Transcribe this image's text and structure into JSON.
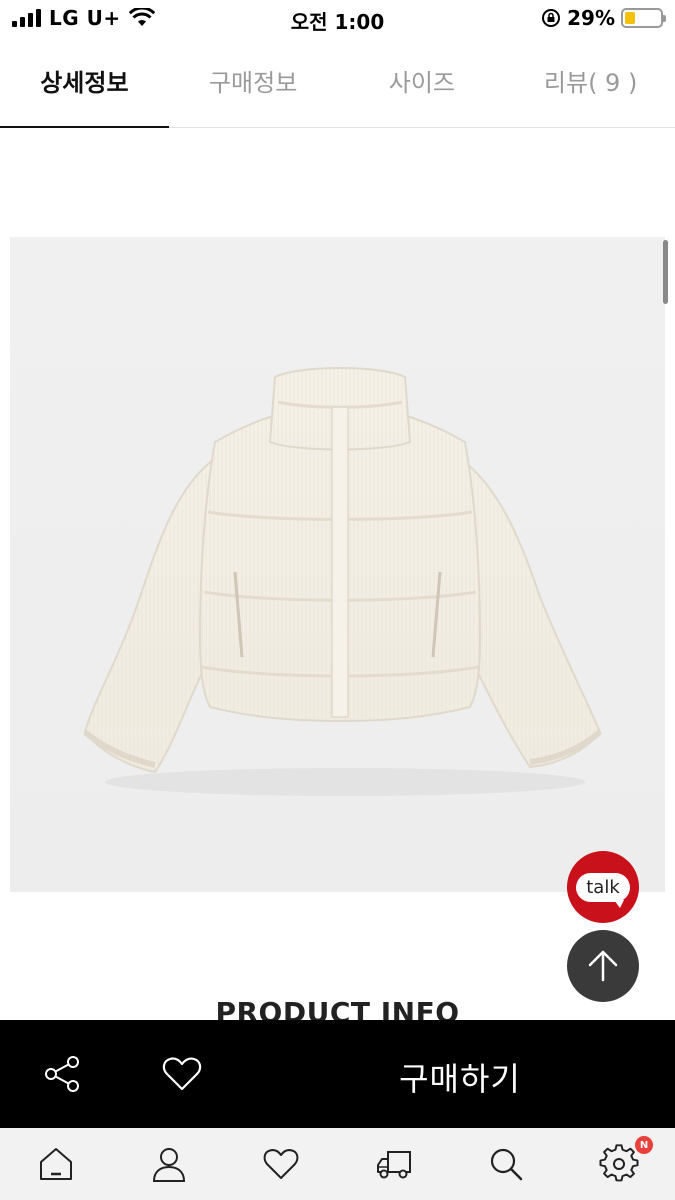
{
  "status_bar": {
    "carrier": "LG U+",
    "time": "오전 1:00",
    "battery_percent_text": "29%",
    "battery_level": 0.29
  },
  "tabs": [
    {
      "label": "상세정보",
      "active": true
    },
    {
      "label": "구매정보",
      "active": false
    },
    {
      "label": "사이즈",
      "active": false
    },
    {
      "label": "리뷰( 9 )",
      "active": false
    }
  ],
  "content": {
    "section_title": "PRODUCT INFO"
  },
  "floating": {
    "talk_label": "talk",
    "talk_color": "#c8111a",
    "top_icon": "arrow-up-icon"
  },
  "buy_bar": {
    "share_icon": "share-icon",
    "wish_icon": "heart-icon",
    "buy_label": "구매하기"
  },
  "bottom_nav": {
    "items": [
      "home-icon",
      "user-icon",
      "heart-icon",
      "truck-icon",
      "search-icon",
      "gear-icon"
    ],
    "badge": "N"
  }
}
